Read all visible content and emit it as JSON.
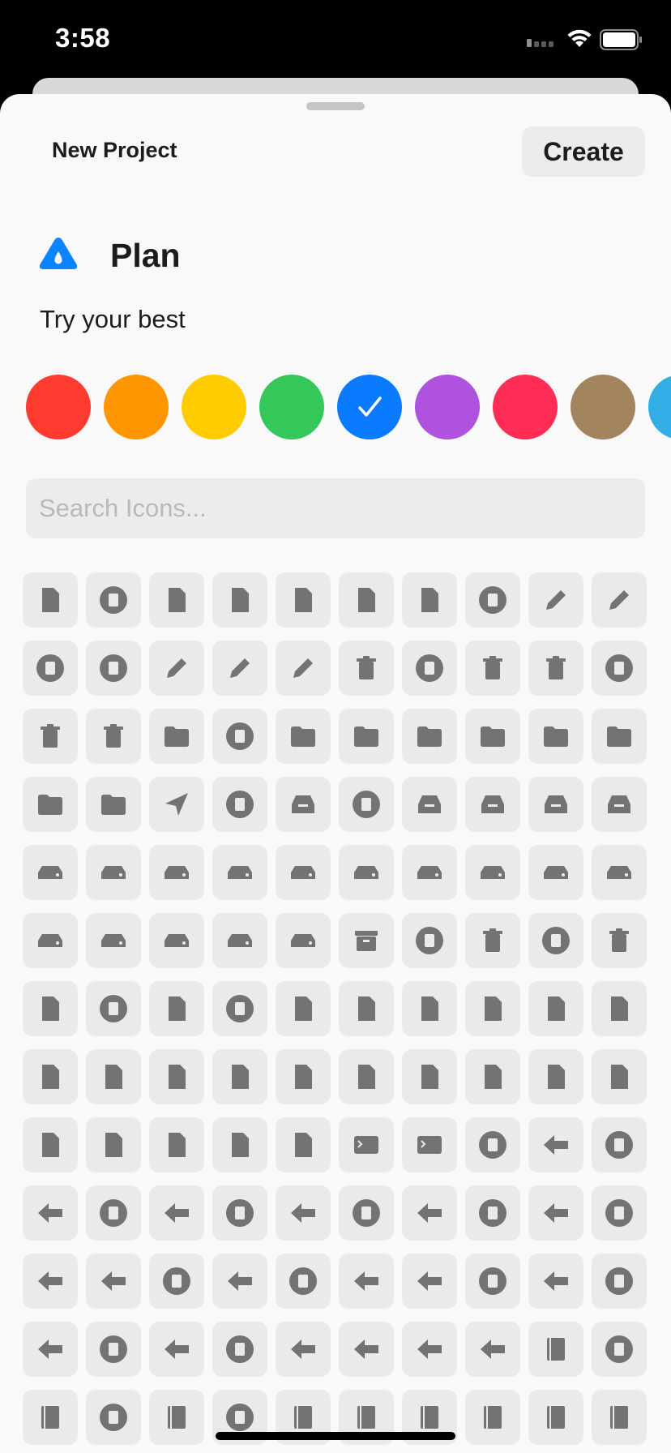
{
  "status_bar": {
    "time": "3:58"
  },
  "sheet": {
    "title": "New Project",
    "create_label": "Create"
  },
  "project": {
    "name": "Plan",
    "description": "Try your best",
    "icon": "drop-triangle-icon",
    "icon_color": "#0a84ff"
  },
  "colors": {
    "options": [
      "#ff3b30",
      "#ff9500",
      "#ffcc00",
      "#34c759",
      "#0a7aff",
      "#af52de",
      "#ff2d55",
      "#a2845e",
      "#32ade6"
    ],
    "selected_index": 4
  },
  "search": {
    "placeholder": "Search Icons..."
  },
  "icon_grid": {
    "icons": [
      "square-and-arrow-up",
      "square-and-arrow-up-circle",
      "square-and-arrow-down",
      "square-and-arrow-up-on-square",
      "square-and-arrow-down-on-square",
      "rectangle-portrait-and-arrow-right",
      "rectangle-portrait-and-arrow-right-fill",
      "pencil-circle",
      "eraser",
      "eraser-line-dashed",
      "square-and-pencil-circle",
      "pencil-tip-circle",
      "pencil-tip-plus",
      "pencil-tip-minus",
      "pencil-tip-arrow",
      "trash",
      "trash-circle",
      "trash-square",
      "trash-slash",
      "trash-slash-circle",
      "trash-slash-square",
      "trash-arrow-up",
      "folder",
      "folder-circle",
      "folder-plus",
      "folder-minus",
      "folder-question",
      "folder-person",
      "folder-dots-plus",
      "folder-gear",
      "rectangle-stack-plus",
      "questionmark-folder",
      "paperplane",
      "paperplane-circle",
      "tray",
      "tray-circle",
      "tray-full",
      "tray-and-arrow-up",
      "tray-and-arrow-down",
      "tray-2",
      "externaldrive",
      "externaldrive-plus",
      "externaldrive-minus",
      "externaldrive-checkmark",
      "externaldrive-xmark",
      "externaldrive-question",
      "externaldrive-exclamation",
      "externaldrive-person",
      "externaldrive-wifi",
      "externaldrive-cloud",
      "externaldrive-trianglebadge",
      "externaldrive-clock",
      "internaldrive",
      "opticaldiscdrive",
      "server-rack",
      "archivebox",
      "archivebox-circle",
      "xmark-bin",
      "xmark-bin-circle",
      "arrow-up-bin",
      "doc",
      "doc-circle",
      "doc-plus",
      "doc-arrow-up-circle",
      "doc-ellipsis",
      "doc-clock",
      "doc-gear",
      "doc-lock",
      "doc-arrow-up",
      "doc-arrow-down",
      "doc-text",
      "doc-on-doc",
      "doc-on-clipboard",
      "clipboard",
      "list-clipboard",
      "clipboard-text",
      "doc-richtext",
      "doc-plaintext",
      "doc-quote",
      "doc-waveform",
      "doc-questionmark",
      "doc-text-image",
      "doc-append",
      "list-bullet-rectangle-portrait",
      "list-bullet-rectangle",
      "terminal",
      "apple-terminal-on-rectangle",
      "calendar-circle",
      "arrowshape-left",
      "arrowshape-left-circle",
      "arrowshape-backward",
      "arrowshape-backward-circle",
      "arrowshape-right",
      "arrowshape-right-circle",
      "arrowshape-forward",
      "arrowshape-forward-circle",
      "arrowshape-up",
      "arrowshape-up-circle",
      "arrowshape-down",
      "arrowshape-down-circle",
      "arrowshape-left-arrowshape-right",
      "arrowshape-turn-up-left",
      "arrowshape-turn-up-left-circle",
      "arrowshape-turn-up-backward",
      "arrowshape-turn-up-backward-circle",
      "arrowshape-turn-up-backward-badge-clock",
      "arrowshape-turn-up-right",
      "arrowshape-turn-up-right-circle",
      "arrowshape-turn-up-forward",
      "arrowshape-turn-up-forward-circle",
      "arrowshape-turn-up-left-2",
      "arrowshape-turn-up-left-2-circle",
      "arrowshape-turn-up-backward-2",
      "arrowshape-turn-up-backward-2-circle",
      "arrowshape-zigzag-right",
      "arrowshape-zigzag-forward",
      "arrowshape-bounce-right",
      "arrowshape-bounce-forward",
      "book",
      "book-circle",
      "books-vertical",
      "books-vertical-circle",
      "book-closed",
      "book-closed-circle",
      "character-book-closed",
      "text-book-closed",
      "menucard",
      "magazine",
      "book-pages",
      "newspaper"
    ]
  }
}
